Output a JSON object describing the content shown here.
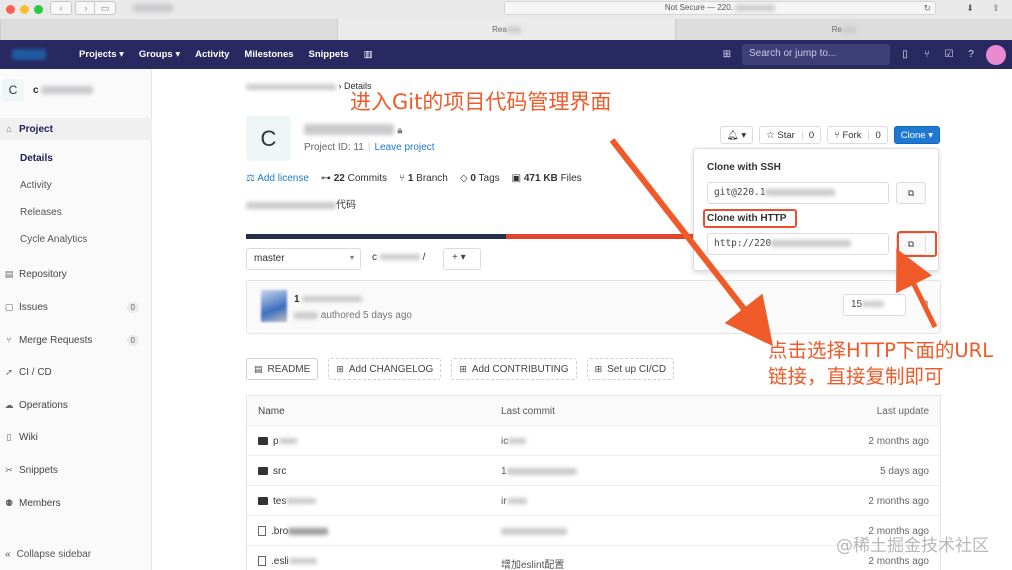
{
  "browser": {
    "address": "Not Secure — 220.",
    "tabs": [
      "",
      "Rea",
      "Re"
    ]
  },
  "header": {
    "nav": [
      "Projects ▾",
      "Groups ▾",
      "Activity",
      "Milestones",
      "Snippets",
      "▥"
    ],
    "search_placeholder": "Search or jump to..."
  },
  "sidebar": {
    "avatar_letter": "C",
    "project_name": "c",
    "project": "Project",
    "details": "Details",
    "activity": "Activity",
    "releases": "Releases",
    "cycle_analytics": "Cycle Analytics",
    "repository": "Repository",
    "issues": "Issues",
    "issues_count": "0",
    "merge_requests": "Merge Requests",
    "merge_requests_count": "0",
    "cicd": "CI / CD",
    "operations": "Operations",
    "wiki": "Wiki",
    "snippets": "Snippets",
    "members": "Members",
    "collapse": "Collapse sidebar"
  },
  "main": {
    "breadcrumb": "Details",
    "avatar_letter": "C",
    "project_id": "Project ID: 11",
    "leave_project": "Leave project",
    "add_license": "Add license",
    "commits_num": "22",
    "commits_label": "Commits",
    "branch_num": "1",
    "branch_label": "Branch",
    "tags_num": "0",
    "tags_label": "Tags",
    "files_size": "471 KB",
    "files_label": "Files",
    "description": "代码",
    "star": "Star",
    "star_count": "0",
    "fork": "Fork",
    "fork_count": "0",
    "clone": "Clone",
    "branch": "master",
    "path": "c",
    "path_sep": "/",
    "plus": "+",
    "commit_title": "1",
    "commit_meta": "authored 5 days ago",
    "commit_sha": "15"
  },
  "file_buttons": [
    "README",
    "Add CHANGELOG",
    "Add CONTRIBUTING",
    "Set up CI/CD"
  ],
  "table": {
    "headers": [
      "Name",
      "Last commit",
      "Last update"
    ],
    "rows": [
      {
        "name": "p",
        "commit": "ic",
        "updated": "2 months ago"
      },
      {
        "name": "src",
        "commit": "1",
        "updated": "5 days ago"
      },
      {
        "name": "tes",
        "commit": "ir",
        "updated": "2 months ago"
      },
      {
        "name": ".bro",
        "commit": "",
        "updated": "2 months ago"
      },
      {
        "name": ".esli",
        "commit": "增加eslint配置",
        "updated": "2 months ago"
      }
    ]
  },
  "clone_dropdown": {
    "ssh_label": "Clone with SSH",
    "ssh_url": "git@220.1",
    "http_label": "Clone with HTTP",
    "http_url": "http://220"
  },
  "annotations": {
    "top": "进入Git的项目代码管理界面",
    "right": "点击选择HTTP下面的URL链接，直接复制即可"
  },
  "watermark": "@稀土掘金技术社区",
  "colors": {
    "header_bg": "#292961",
    "accent": "#1f78d1",
    "annotation": "#f05a28",
    "highlight": "#e8502b"
  }
}
